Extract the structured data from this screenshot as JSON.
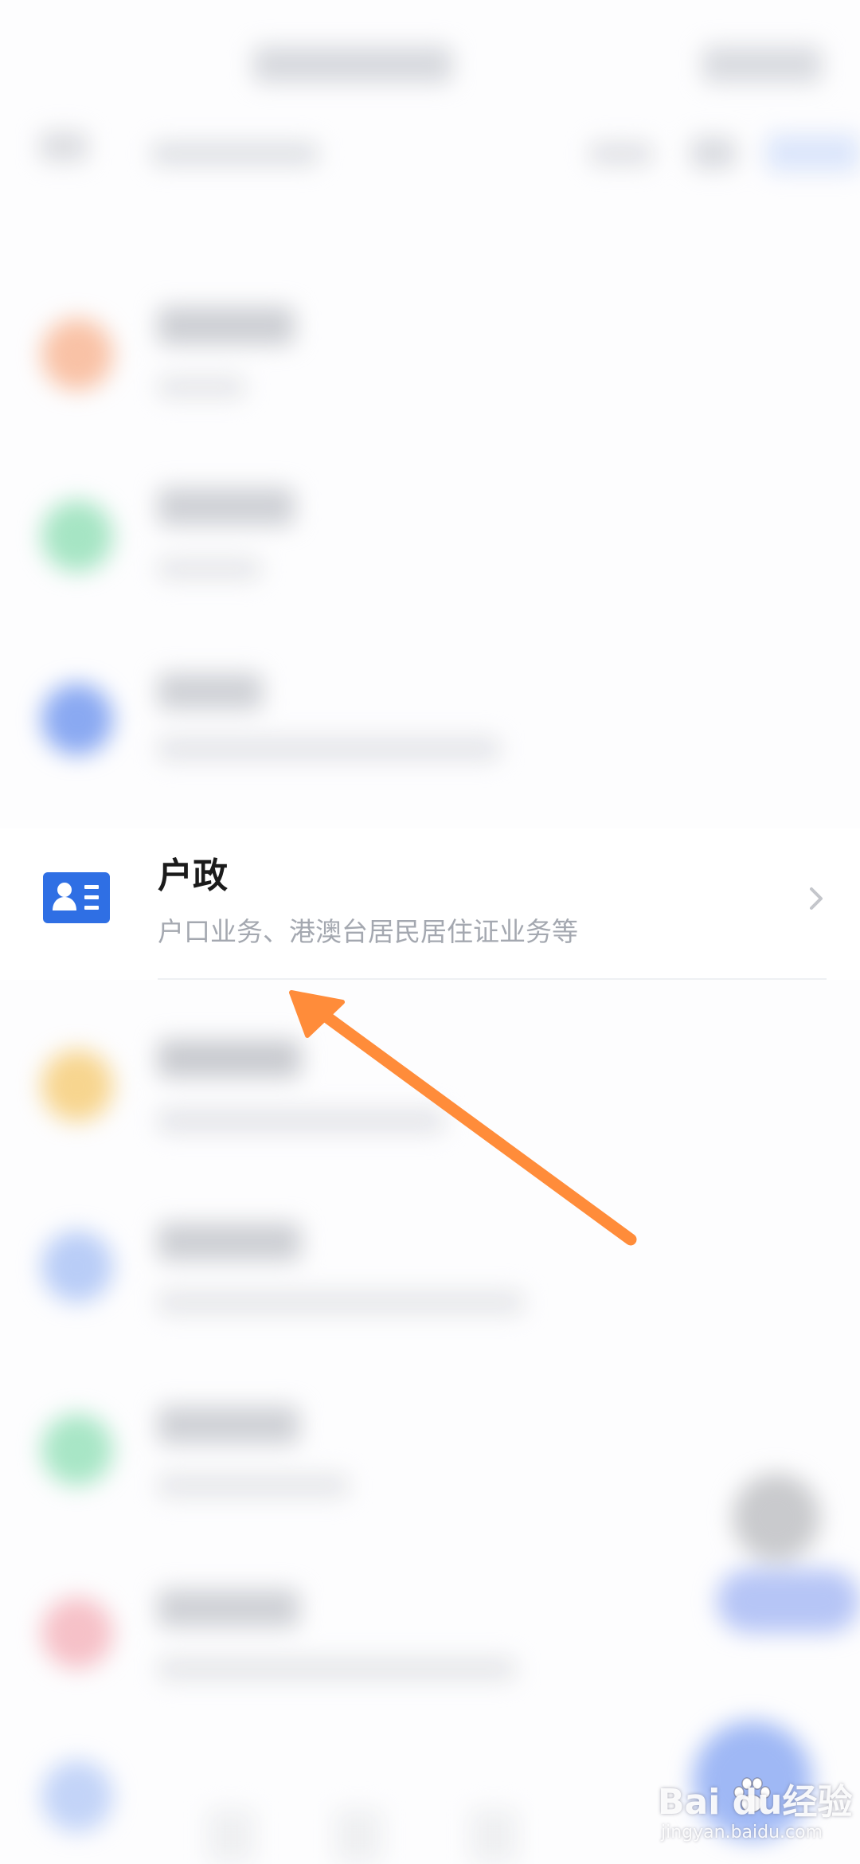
{
  "service_item": {
    "title": "户政",
    "description": "户口业务、港澳台居民居住证业务等",
    "icon": "id-card-icon",
    "icon_color": "#2f6fe4"
  },
  "annotation": {
    "arrow_color": "#ff8c3a"
  },
  "watermark": {
    "brand": "Bai  du经验",
    "url": "jingyan.baidu.com"
  }
}
